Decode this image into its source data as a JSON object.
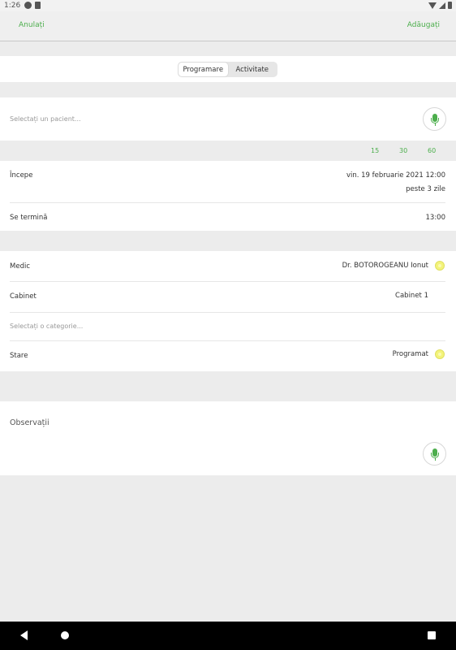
{
  "status_bar": {
    "time": "1:26"
  },
  "toolbar": {
    "cancel_label": "Anulați",
    "add_label": "Adăugați"
  },
  "segment": {
    "tabs": [
      "Programare",
      "Activitate"
    ],
    "active": "Programare"
  },
  "patient": {
    "placeholder": "Selectați un pacient..."
  },
  "quick_durations": [
    "15",
    "30",
    "60"
  ],
  "start": {
    "label": "Începe",
    "value": "vin. 19 februarie 2021 12:00",
    "relative": "peste 3 zile"
  },
  "end": {
    "label": "Se termină",
    "value": "13:00"
  },
  "details": {
    "doctor": {
      "label": "Medic",
      "value": "Dr. BOTOROGEANU Ionut"
    },
    "cabinet": {
      "label": "Cabinet",
      "value": "Cabinet 1"
    },
    "category": {
      "placeholder": "Selectați o categorie..."
    },
    "status": {
      "label": "Stare",
      "value": "Programat"
    }
  },
  "notes": {
    "label": "Observații"
  },
  "colors": {
    "accent": "#4cae4c",
    "status_ring": "#f3f37a",
    "background": "#ececec"
  },
  "icons": [
    "microphone-icon",
    "status-ring-icon",
    "nav-back-icon",
    "nav-home-icon",
    "nav-recent-icon"
  ]
}
